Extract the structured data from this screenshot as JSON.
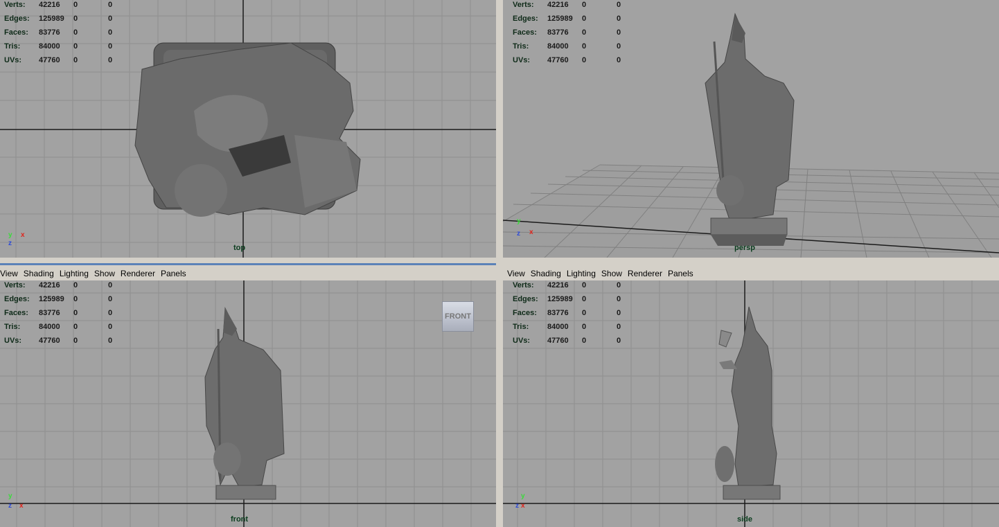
{
  "stats": {
    "labels": [
      "Verts:",
      "Edges:",
      "Faces:",
      "Tris:",
      "UVs:"
    ],
    "values": [
      [
        "42216",
        "0",
        "0"
      ],
      [
        "125989",
        "0",
        "0"
      ],
      [
        "83776",
        "0",
        "0"
      ],
      [
        "84000",
        "0",
        "0"
      ],
      [
        "47760",
        "0",
        "0"
      ]
    ]
  },
  "menu": [
    "View",
    "Shading",
    "Lighting",
    "Show",
    "Renderer",
    "Panels"
  ],
  "panes": {
    "top": {
      "camera": "top"
    },
    "persp": {
      "camera": "persp"
    },
    "front": {
      "camera": "front"
    },
    "side": {
      "camera": "side"
    }
  },
  "viewcube_label": "FRONT",
  "axis_labels": {
    "x": "x",
    "y": "y",
    "z": "z"
  },
  "colors": {
    "viewport_bg": "#a2a2a2",
    "grid": "#8f8f8f",
    "axis_x": "#e0251c",
    "axis_y": "#3adc3a",
    "axis_z": "#2d4bd8",
    "chrome": "#d4d0c8"
  }
}
